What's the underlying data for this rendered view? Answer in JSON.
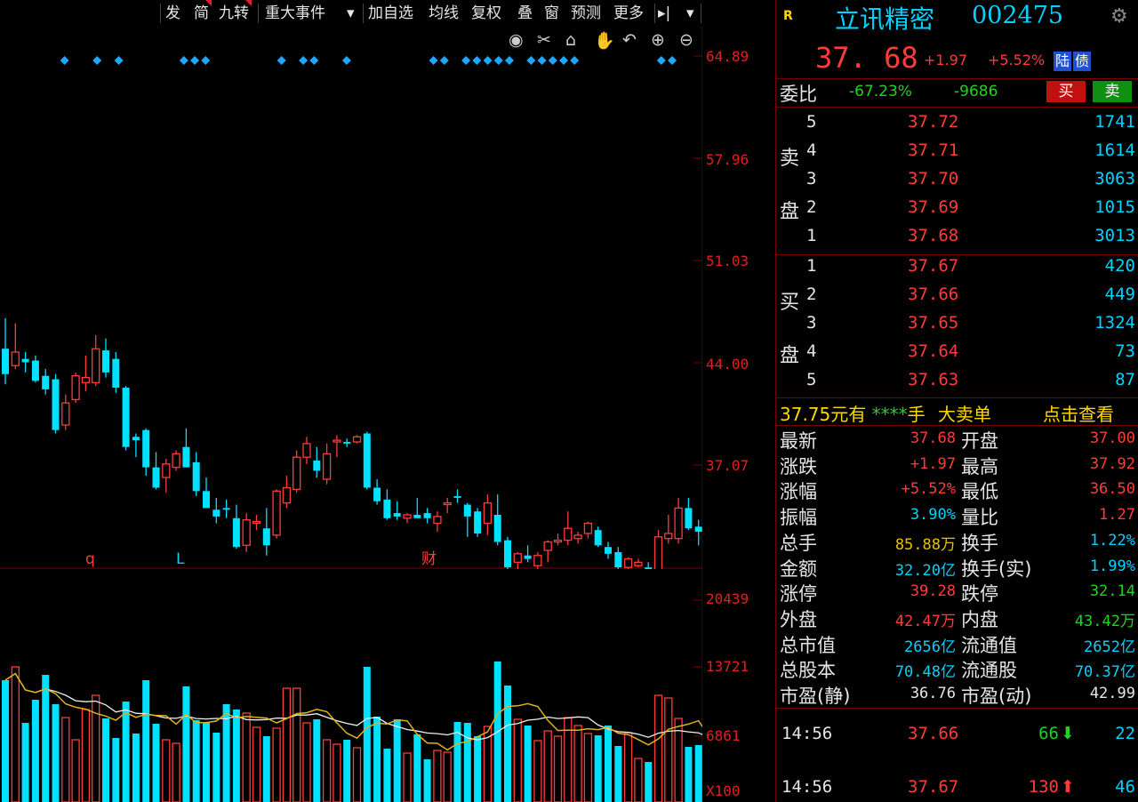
{
  "toolbar": {
    "items": [
      {
        "label": "发",
        "flag": false
      },
      {
        "label": "简",
        "flag": true
      },
      {
        "label": "九转",
        "flag": true
      },
      {
        "label": "重大事件",
        "flag": false
      },
      {
        "label": "▾",
        "flag": false
      },
      {
        "label": "加自选",
        "flag": false
      },
      {
        "label": "均线",
        "flag": false
      },
      {
        "label": "复权",
        "flag": false
      },
      {
        "label": "叠",
        "flag": false
      },
      {
        "label": "窗",
        "flag": false
      },
      {
        "label": "预测",
        "flag": false
      },
      {
        "label": "更多",
        "flag": false
      },
      {
        "label": "▸|",
        "flag": false
      },
      {
        "label": "▾",
        "flag": false
      }
    ],
    "icons": [
      "eye-icon",
      "scissors-icon",
      "lock-icon",
      "hand-icon",
      "undo-icon",
      "zoom-in-icon",
      "zoom-out-icon"
    ]
  },
  "chart_data": {
    "type": "candlestick",
    "price_axis_ticks": [
      "64.89",
      "57.96",
      "51.03",
      "44.00",
      "37.07"
    ],
    "volume_axis_ticks": [
      "20439",
      "13721",
      "6861",
      "X100"
    ],
    "price_ylim": [
      34.0,
      66.0
    ],
    "volume_ylim": [
      0,
      24000
    ],
    "event_markers": [
      "q",
      "L",
      "财"
    ],
    "candles": [
      {
        "o": 47.0,
        "h": 48.8,
        "l": 44.9,
        "c": 45.5,
        "v": 13700
      },
      {
        "o": 46.0,
        "h": 48.5,
        "l": 45.8,
        "c": 46.8,
        "v": 15200
      },
      {
        "o": 46.4,
        "h": 46.8,
        "l": 45.6,
        "c": 46.2,
        "v": 8900
      },
      {
        "o": 46.3,
        "h": 46.6,
        "l": 45.0,
        "c": 45.1,
        "v": 11500
      },
      {
        "o": 45.4,
        "h": 45.8,
        "l": 44.3,
        "c": 44.6,
        "v": 14300
      },
      {
        "o": 45.2,
        "h": 45.5,
        "l": 42.0,
        "c": 42.2,
        "v": 11000
      },
      {
        "o": 42.5,
        "h": 44.3,
        "l": 42.2,
        "c": 43.8,
        "v": 9500
      },
      {
        "o": 44.0,
        "h": 45.6,
        "l": 43.8,
        "c": 45.4,
        "v": 7000
      },
      {
        "o": 45.0,
        "h": 46.6,
        "l": 44.5,
        "c": 45.3,
        "v": 10400
      },
      {
        "o": 45.0,
        "h": 47.8,
        "l": 44.8,
        "c": 47.0,
        "v": 12000
      },
      {
        "o": 46.9,
        "h": 47.6,
        "l": 45.3,
        "c": 45.6,
        "v": 9400
      },
      {
        "o": 46.4,
        "h": 46.8,
        "l": 44.4,
        "c": 44.7,
        "v": 7200
      },
      {
        "o": 44.7,
        "h": 44.8,
        "l": 41.0,
        "c": 41.2,
        "v": 11300
      },
      {
        "o": 41.8,
        "h": 42.0,
        "l": 40.6,
        "c": 41.6,
        "v": 7700
      },
      {
        "o": 42.2,
        "h": 42.3,
        "l": 39.5,
        "c": 40.0,
        "v": 13700
      },
      {
        "o": 40.0,
        "h": 40.9,
        "l": 38.7,
        "c": 38.8,
        "v": 8800
      },
      {
        "o": 39.4,
        "h": 40.5,
        "l": 38.5,
        "c": 40.2,
        "v": 7000
      },
      {
        "o": 40.0,
        "h": 41.0,
        "l": 39.8,
        "c": 40.8,
        "v": 6600
      },
      {
        "o": 41.2,
        "h": 42.3,
        "l": 40.0,
        "c": 40.0,
        "v": 13000
      },
      {
        "o": 40.3,
        "h": 40.9,
        "l": 38.3,
        "c": 38.6,
        "v": 9200
      },
      {
        "o": 38.6,
        "h": 39.4,
        "l": 37.6,
        "c": 37.6,
        "v": 8900
      },
      {
        "o": 37.5,
        "h": 38.2,
        "l": 36.7,
        "c": 37.1,
        "v": 7800
      },
      {
        "o": 37.6,
        "h": 38.1,
        "l": 37.0,
        "c": 37.5,
        "v": 11000
      },
      {
        "o": 37.0,
        "h": 37.8,
        "l": 35.2,
        "c": 35.3,
        "v": 10400
      },
      {
        "o": 35.4,
        "h": 37.3,
        "l": 35.0,
        "c": 36.9,
        "v": 10000
      },
      {
        "o": 36.7,
        "h": 37.2,
        "l": 36.3,
        "c": 36.8,
        "v": 8400
      },
      {
        "o": 36.4,
        "h": 37.6,
        "l": 34.8,
        "c": 35.4,
        "v": 7400
      },
      {
        "o": 36.0,
        "h": 38.7,
        "l": 35.8,
        "c": 38.6,
        "v": 8300
      },
      {
        "o": 37.9,
        "h": 39.5,
        "l": 37.6,
        "c": 38.8,
        "v": 12800
      },
      {
        "o": 38.7,
        "h": 41.0,
        "l": 38.5,
        "c": 40.6,
        "v": 12800
      },
      {
        "o": 40.6,
        "h": 41.8,
        "l": 40.2,
        "c": 41.4,
        "v": 8900
      },
      {
        "o": 40.4,
        "h": 41.2,
        "l": 39.4,
        "c": 39.8,
        "v": 9300
      },
      {
        "o": 39.3,
        "h": 41.4,
        "l": 39.0,
        "c": 40.8,
        "v": 7000
      },
      {
        "o": 41.5,
        "h": 41.9,
        "l": 40.6,
        "c": 41.6,
        "v": 6500
      },
      {
        "o": 41.5,
        "h": 41.7,
        "l": 41.2,
        "c": 41.4,
        "v": 7000
      },
      {
        "o": 41.5,
        "h": 41.9,
        "l": 41.4,
        "c": 41.8,
        "v": 6100
      },
      {
        "o": 42.0,
        "h": 42.1,
        "l": 38.7,
        "c": 38.8,
        "v": 15200
      },
      {
        "o": 38.8,
        "h": 39.3,
        "l": 37.8,
        "c": 38.0,
        "v": 9600
      },
      {
        "o": 38.1,
        "h": 38.7,
        "l": 36.9,
        "c": 37.0,
        "v": 6000
      },
      {
        "o": 37.3,
        "h": 38.0,
        "l": 36.9,
        "c": 37.1,
        "v": 9300
      },
      {
        "o": 37.0,
        "h": 37.3,
        "l": 36.7,
        "c": 37.2,
        "v": 5500
      },
      {
        "o": 37.2,
        "h": 38.2,
        "l": 37.0,
        "c": 37.0,
        "v": 7600
      },
      {
        "o": 37.3,
        "h": 37.6,
        "l": 36.7,
        "c": 37.0,
        "v": 4800
      },
      {
        "o": 36.7,
        "h": 37.4,
        "l": 36.2,
        "c": 37.1,
        "v": 5800
      },
      {
        "o": 37.8,
        "h": 38.2,
        "l": 37.3,
        "c": 37.9,
        "v": 5600
      },
      {
        "o": 38.3,
        "h": 38.7,
        "l": 37.9,
        "c": 38.2,
        "v": 9000
      },
      {
        "o": 37.8,
        "h": 37.9,
        "l": 35.9,
        "c": 37.1,
        "v": 8900
      },
      {
        "o": 37.4,
        "h": 37.6,
        "l": 35.9,
        "c": 36.1,
        "v": 7400
      },
      {
        "o": 36.7,
        "h": 38.4,
        "l": 36.0,
        "c": 37.9,
        "v": 8500
      },
      {
        "o": 37.2,
        "h": 38.4,
        "l": 35.4,
        "c": 35.6,
        "v": 15800
      },
      {
        "o": 35.7,
        "h": 35.9,
        "l": 33.9,
        "c": 34.1,
        "v": 13100
      },
      {
        "o": 34.4,
        "h": 35.0,
        "l": 34.0,
        "c": 34.9,
        "v": 9300
      },
      {
        "o": 34.8,
        "h": 35.4,
        "l": 34.4,
        "c": 34.6,
        "v": 8600
      },
      {
        "o": 34.2,
        "h": 35.0,
        "l": 33.8,
        "c": 34.8,
        "v": 6900
      },
      {
        "o": 35.1,
        "h": 35.7,
        "l": 34.4,
        "c": 35.6,
        "v": 8000
      },
      {
        "o": 35.6,
        "h": 36.1,
        "l": 35.4,
        "c": 35.7,
        "v": 7400
      },
      {
        "o": 35.7,
        "h": 37.4,
        "l": 35.4,
        "c": 36.4,
        "v": 9500
      },
      {
        "o": 35.8,
        "h": 36.2,
        "l": 35.5,
        "c": 36.0,
        "v": 8600
      },
      {
        "o": 36.1,
        "h": 36.8,
        "l": 35.8,
        "c": 36.7,
        "v": 7700
      },
      {
        "o": 36.3,
        "h": 36.5,
        "l": 35.3,
        "c": 35.4,
        "v": 7500
      },
      {
        "o": 35.3,
        "h": 35.6,
        "l": 34.6,
        "c": 34.9,
        "v": 8600
      },
      {
        "o": 35.0,
        "h": 35.3,
        "l": 34.0,
        "c": 34.1,
        "v": 6300
      },
      {
        "o": 34.1,
        "h": 34.7,
        "l": 33.9,
        "c": 34.6,
        "v": 7800
      },
      {
        "o": 34.2,
        "h": 34.6,
        "l": 34.1,
        "c": 34.4,
        "v": 4900
      },
      {
        "o": 34.1,
        "h": 34.4,
        "l": 33.8,
        "c": 34.0,
        "v": 4500
      },
      {
        "o": 33.9,
        "h": 36.3,
        "l": 33.8,
        "c": 35.9,
        "v": 12000
      },
      {
        "o": 35.8,
        "h": 37.2,
        "l": 35.5,
        "c": 36.1,
        "v": 11700
      },
      {
        "o": 35.8,
        "h": 38.2,
        "l": 35.5,
        "c": 37.6,
        "v": 9400
      },
      {
        "o": 37.6,
        "h": 38.2,
        "l": 36.3,
        "c": 36.4,
        "v": 6200
      },
      {
        "o": 36.5,
        "h": 36.9,
        "l": 35.4,
        "c": 36.2,
        "v": 6400
      },
      {
        "o": 36.5,
        "h": 37.3,
        "l": 36.4,
        "c": 36.8,
        "v": 3400
      },
      {
        "o": 37.0,
        "h": 37.9,
        "l": 36.5,
        "c": 37.7,
        "v": 10800
      }
    ]
  },
  "stock": {
    "r_badge": "R",
    "name": "立讯精密",
    "code": "002475",
    "price": "37. 68",
    "change": "+1.97",
    "pct": "+5.52%",
    "badge1": "陆",
    "badge2": "债"
  },
  "weibi": {
    "label": "委比",
    "pct": "-67.23%",
    "diff": "-9686",
    "buy_btn": "买",
    "sell_btn": "卖"
  },
  "sell_side": {
    "label1": "卖",
    "label2": "盘",
    "levels": [
      {
        "n": "5",
        "price": "37.72",
        "vol": "1741"
      },
      {
        "n": "4",
        "price": "37.71",
        "vol": "1614"
      },
      {
        "n": "3",
        "price": "37.70",
        "vol": "3063"
      },
      {
        "n": "2",
        "price": "37.69",
        "vol": "1015"
      },
      {
        "n": "1",
        "price": "37.68",
        "vol": "3013"
      }
    ]
  },
  "buy_side": {
    "label1": "买",
    "label2": "盘",
    "levels": [
      {
        "n": "1",
        "price": "37.67",
        "vol": "420"
      },
      {
        "n": "2",
        "price": "37.66",
        "vol": "449"
      },
      {
        "n": "3",
        "price": "37.65",
        "vol": "1324"
      },
      {
        "n": "4",
        "price": "37.64",
        "vol": "73"
      },
      {
        "n": "5",
        "price": "37.63",
        "vol": "87"
      }
    ]
  },
  "big_order": {
    "price": "37.75",
    "text1": "元有",
    "stars": "****",
    "text2": "手",
    "text3": "大卖单",
    "link": "点击查看"
  },
  "stats": {
    "rows": [
      {
        "l1": "最新",
        "v1": "37.68",
        "c1": "r",
        "l2": "开盘",
        "v2": "37.00",
        "c2": "r"
      },
      {
        "l1": "涨跌",
        "v1": "+1.97",
        "c1": "r",
        "l2": "最高",
        "v2": "37.92",
        "c2": "r"
      },
      {
        "l1": "涨幅",
        "v1": "+5.52%",
        "c1": "r",
        "l2": "最低",
        "v2": "36.50",
        "c2": "r"
      },
      {
        "l1": "振幅",
        "v1": "3.90%",
        "c1": "c",
        "l2": "量比",
        "v2": "1.27",
        "c2": "r"
      },
      {
        "l1": "总手",
        "v1": "85.88万",
        "c1": "o",
        "l2": "换手",
        "v2": "1.22%",
        "c2": "c"
      },
      {
        "l1": "金额",
        "v1": "32.20亿",
        "c1": "c",
        "l2": "换手(实)",
        "v2": "1.99%",
        "c2": "c"
      },
      {
        "l1": "涨停",
        "v1": "39.28",
        "c1": "r",
        "l2": "跌停",
        "v2": "32.14",
        "c2": "g"
      },
      {
        "l1": "外盘",
        "v1": "42.47万",
        "c1": "r",
        "l2": "内盘",
        "v2": "43.42万",
        "c2": "g"
      },
      {
        "l1": "总市值",
        "v1": "2656亿",
        "c1": "c",
        "l2": "流通值",
        "v2": "2652亿",
        "c2": "c"
      },
      {
        "l1": "总股本",
        "v1": "70.48亿",
        "c1": "c",
        "l2": "流通股",
        "v2": "70.37亿",
        "c2": "c"
      },
      {
        "l1": "市盈(静)",
        "v1": "36.76",
        "c1": "w",
        "l2": "市盈(动)",
        "v2": "42.99",
        "c2": "w"
      }
    ]
  },
  "ticks": [
    {
      "time": "14:56",
      "price": "37.66",
      "vol": "66",
      "dir": "down",
      "n": "22"
    },
    {
      "time": "14:56",
      "price": "37.67",
      "vol": "130",
      "dir": "up",
      "n": "46"
    }
  ],
  "colors": {
    "up": "#ff3b3b",
    "down": "#00e0ff",
    "ma_white": "#f0f0f0",
    "ma_yellow": "#e0b020",
    "border": "#7a0000"
  }
}
